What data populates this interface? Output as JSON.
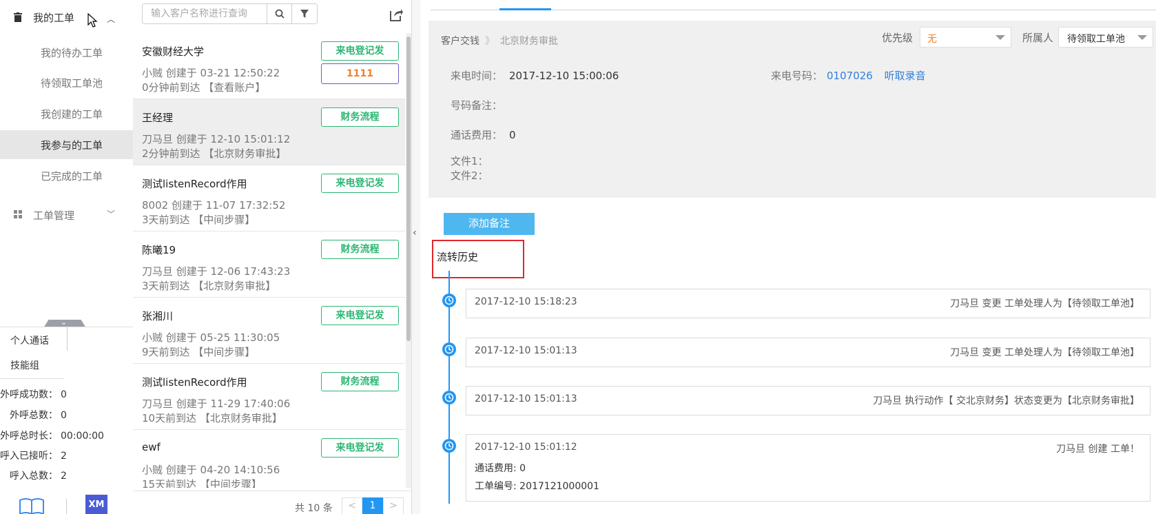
{
  "sidebar": {
    "my_orders_label": "我的工单",
    "items": [
      {
        "label": "我的待办工单"
      },
      {
        "label": "待领取工单池"
      },
      {
        "label": "我创建的工单"
      },
      {
        "label": "我参与的工单"
      },
      {
        "label": "已完成的工单"
      }
    ],
    "management_label": "工单管理",
    "stats": {
      "tab_personal": "个人通话",
      "tab_skill": "技能组",
      "rows": [
        {
          "label": "外呼成功数：",
          "value": "0"
        },
        {
          "label": "外呼总数：",
          "value": "0"
        },
        {
          "label": "外呼总时长：",
          "value": "00:00:00"
        },
        {
          "label": "呼入已接听：",
          "value": "2"
        },
        {
          "label": "呼入总数：",
          "value": "2"
        }
      ]
    },
    "logo_text": "XM"
  },
  "list": {
    "search_placeholder": "输入客户名称进行查询",
    "items": [
      {
        "name": "安徽财经大学",
        "meta": "小贼 创建于 03-21 12:50:22",
        "arrive": "0分钟前到达 【查看账户】",
        "tag": "来电登记发",
        "tag2": "1111"
      },
      {
        "name": "王经理",
        "meta": "刀马旦 创建于 12-10 15:01:12",
        "arrive": "2分钟前到达 【北京财务审批】",
        "tag": "财务流程"
      },
      {
        "name": "测试listenRecord作用",
        "meta": "8002 创建于 11-07 17:32:52",
        "arrive": "3天前到达 【中间步骤】",
        "tag": "来电登记发"
      },
      {
        "name": "陈曦19",
        "meta": "刀马旦 创建于 12-06 17:43:23",
        "arrive": "3天前到达 【北京财务审批】",
        "tag": "财务流程"
      },
      {
        "name": "张湘川",
        "meta": "小贼 创建于 05-25 11:30:05",
        "arrive": "9天前到达 【中间步骤】",
        "tag": "来电登记发"
      },
      {
        "name": "测试listenRecord作用",
        "meta": "刀马旦 创建于 11-29 17:40:06",
        "arrive": "10天前到达 【北京财务审批】",
        "tag": "财务流程"
      },
      {
        "name": "ewf",
        "meta": "小贼 创建于 04-20 14:10:56",
        "arrive": "15天前到达 【中间步骤】",
        "tag": "来电登记发"
      }
    ],
    "total": "共 10 条",
    "page": "1",
    "prev": "<",
    "next": ">"
  },
  "detail": {
    "breadcrumb": {
      "first": "客户交钱",
      "sep": "》",
      "current": "北京财务审批"
    },
    "priority_label": "优先级",
    "priority_value": "无",
    "owner_label": "所属人",
    "owner_value": "待领取工单池",
    "fields": {
      "call_time_label": "来电时间：",
      "call_time_value": "2017-12-10 15:00:06",
      "call_number_label": "来电号码：",
      "call_number_value": "0107026",
      "listen_link": "听取录音",
      "number_note_label": "号码备注：",
      "call_fee_label": "通话费用：",
      "call_fee_value": "0",
      "file1_label": "文件1：",
      "file2_label": "文件2："
    },
    "add_note_label": "添加备注",
    "history_title": "流转历史",
    "history": [
      {
        "time": "2017-12-10 15:18:23",
        "text": "刀马旦 变更 工单处理人为【待领取工单池】"
      },
      {
        "time": "2017-12-10 15:01:13",
        "text": "刀马旦 变更 工单处理人为【待领取工单池】"
      },
      {
        "time": "2017-12-10 15:01:13",
        "text": "刀马旦 执行动作【 交北京财务】状态变更为【北京财务审批】"
      },
      {
        "time": "2017-12-10 15:01:12",
        "text": "刀马旦 创建 工单！",
        "extra1": "通话费用: 0",
        "extra2": "工单编号: 2017121000001"
      }
    ]
  },
  "colors": {
    "accent": "#2196f3",
    "tag_green": "#2bb673",
    "highlight_red": "#e0262b",
    "priority_orange": "#f0802a",
    "link_blue": "#2f7fd8"
  }
}
